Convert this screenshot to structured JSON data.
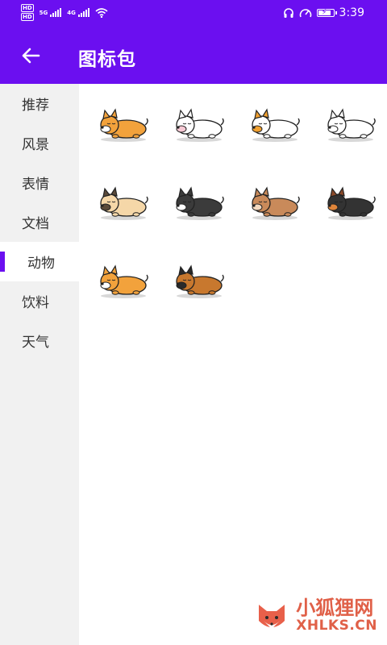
{
  "status_bar": {
    "hd1": "HD",
    "hd2": "HD",
    "net1": "5G",
    "net2": "4G",
    "time": "3:39",
    "battery_level": 0.9
  },
  "header": {
    "title": "图标包",
    "accent": "#6b0ff0"
  },
  "sidebar": {
    "items": [
      {
        "label": "推荐",
        "active": false
      },
      {
        "label": "风景",
        "active": false
      },
      {
        "label": "表情",
        "active": false
      },
      {
        "label": "文档",
        "active": false
      },
      {
        "label": "动物",
        "active": true
      },
      {
        "label": "饮料",
        "active": false
      },
      {
        "label": "天气",
        "active": false
      }
    ]
  },
  "icons": [
    {
      "name": "corgi",
      "body": "#f2a23c",
      "accent": "#ffffff",
      "ear": "#f2a23c"
    },
    {
      "name": "bull-terrier",
      "body": "#ffffff",
      "accent": "#f7c9d4",
      "ear": "#ffffff"
    },
    {
      "name": "jack-russell",
      "body": "#ffffff",
      "accent": "#f0a030",
      "ear": "#f0a030"
    },
    {
      "name": "samoyed",
      "body": "#ffffff",
      "accent": "#ffffff",
      "ear": "#ffffff"
    },
    {
      "name": "pug",
      "body": "#f5d7a8",
      "accent": "#5a4a3a",
      "ear": "#5a4a3a"
    },
    {
      "name": "french-bulldog",
      "body": "#3b3b3b",
      "accent": "#ffffff",
      "ear": "#3b3b3b"
    },
    {
      "name": "chihuahua",
      "body": "#c98a5a",
      "accent": "#f3d9c0",
      "ear": "#c98a5a"
    },
    {
      "name": "beagle",
      "body": "#333333",
      "accent": "#e0853a",
      "ear": "#8b4a2a"
    },
    {
      "name": "shiba",
      "body": "#f2a23c",
      "accent": "#ffffff",
      "ear": "#f2a23c"
    },
    {
      "name": "german-shepherd",
      "body": "#c8782e",
      "accent": "#2a2a2a",
      "ear": "#2a2a2a"
    }
  ],
  "watermark": {
    "cn": "小狐狸网",
    "en": "XHLKS.CN"
  }
}
